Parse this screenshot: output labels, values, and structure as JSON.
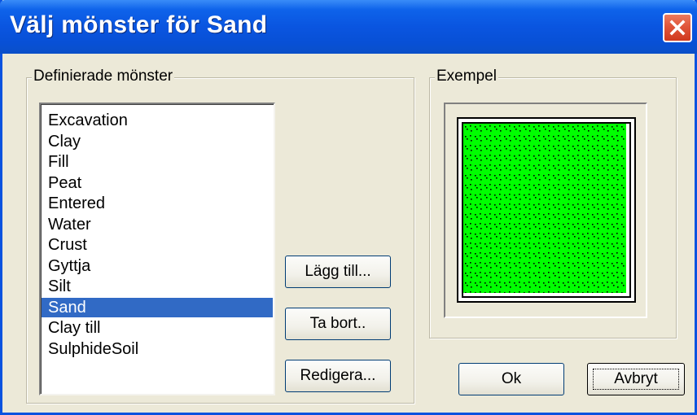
{
  "window": {
    "title": "Välj mönster för Sand",
    "close_icon": "close-icon"
  },
  "defined_patterns": {
    "label": "Definierade mönster",
    "items": [
      {
        "label": "Excavation",
        "selected": false
      },
      {
        "label": "Clay",
        "selected": false
      },
      {
        "label": "Fill",
        "selected": false
      },
      {
        "label": "Peat",
        "selected": false
      },
      {
        "label": "Entered",
        "selected": false
      },
      {
        "label": "Water",
        "selected": false
      },
      {
        "label": "Crust",
        "selected": false
      },
      {
        "label": "Gyttja",
        "selected": false
      },
      {
        "label": "Silt",
        "selected": false
      },
      {
        "label": "Sand",
        "selected": true
      },
      {
        "label": "Clay till",
        "selected": false
      },
      {
        "label": "SulphideSoil",
        "selected": false
      }
    ],
    "add_button": "Lägg till...",
    "remove_button": "Ta bort..",
    "edit_button": "Redigera..."
  },
  "example": {
    "label": "Exempel",
    "pattern_fill_color": "#00ff00",
    "pattern_mark_color": "#000000"
  },
  "footer": {
    "ok_button": "Ok",
    "cancel_button": "Avbryt"
  },
  "colors": {
    "titlebar": "#0a55e0",
    "selection": "#316ac5",
    "dialog_bg": "#ece9d8"
  }
}
